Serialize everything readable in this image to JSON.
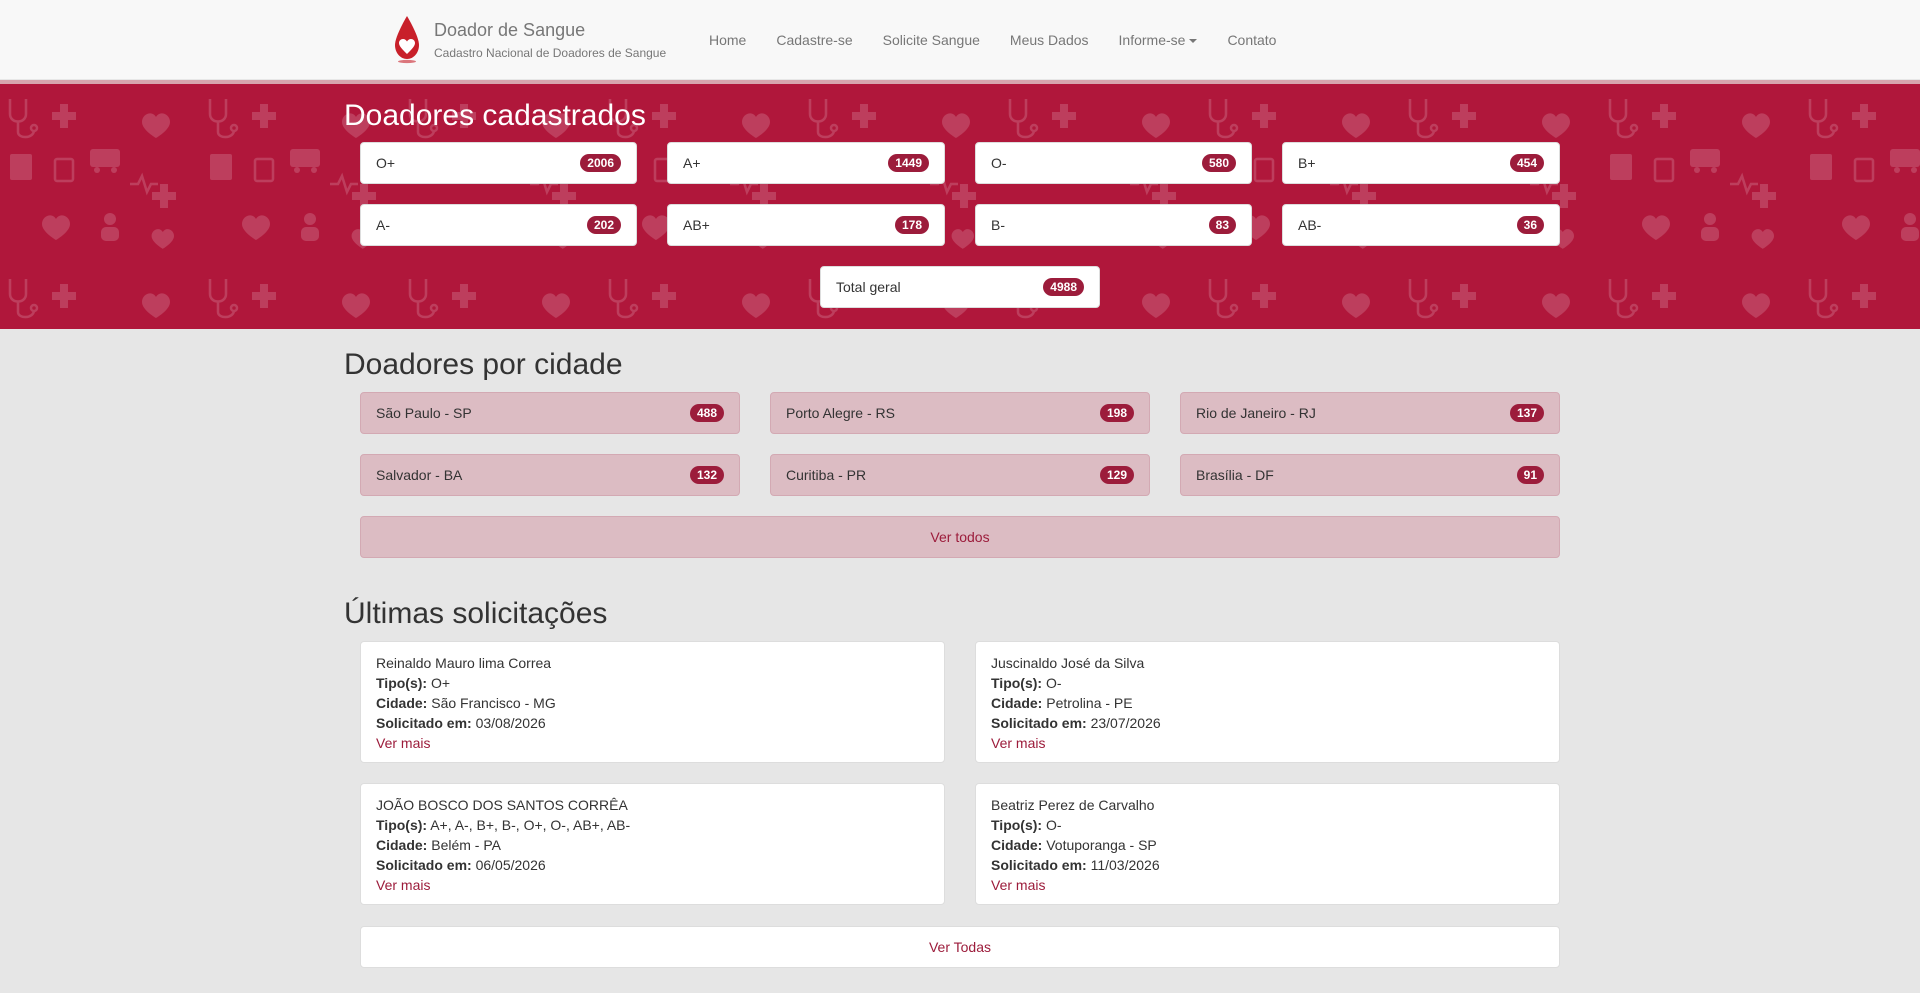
{
  "brand": {
    "title": "Doador de Sangue",
    "subtitle": "Cadastro Nacional de Doadores de Sangue",
    "logo_icon": "blood-drop-heart-icon"
  },
  "nav": {
    "items": [
      "Home",
      "Cadastre-se",
      "Solicite Sangue",
      "Meus Dados",
      "Informe-se",
      "Contato"
    ]
  },
  "colors": {
    "accent": "#9c1c3b",
    "hero_bg": "#b0173b",
    "city_box_bg": "#dcbcc3",
    "page_bg": "#e6e6e6"
  },
  "donors": {
    "title": "Doadores cadastrados",
    "types": [
      {
        "label": "O+",
        "count": "2006"
      },
      {
        "label": "A+",
        "count": "1449"
      },
      {
        "label": "O-",
        "count": "580"
      },
      {
        "label": "B+",
        "count": "454"
      },
      {
        "label": "A-",
        "count": "202"
      },
      {
        "label": "AB+",
        "count": "178"
      },
      {
        "label": "B-",
        "count": "83"
      },
      {
        "label": "AB-",
        "count": "36"
      }
    ],
    "total_label": "Total geral",
    "total_count": "4988"
  },
  "cities": {
    "title": "Doadores por cidade",
    "items": [
      {
        "label": "São Paulo - SP",
        "count": "488"
      },
      {
        "label": "Porto Alegre - RS",
        "count": "198"
      },
      {
        "label": "Rio de Janeiro - RJ",
        "count": "137"
      },
      {
        "label": "Salvador - BA",
        "count": "132"
      },
      {
        "label": "Curitiba - PR",
        "count": "129"
      },
      {
        "label": "Brasília - DF",
        "count": "91"
      }
    ],
    "see_all": "Ver todos"
  },
  "requests": {
    "title": "Últimas solicitações",
    "labels": {
      "types": "Tipo(s):",
      "city": "Cidade:",
      "requested": "Solicitado em:",
      "more": "Ver mais"
    },
    "items": [
      {
        "name": "Reinaldo Mauro lima Correa",
        "types": "O+",
        "city": "São Francisco - MG",
        "date": "03/08/2026"
      },
      {
        "name": "Juscinaldo José da Silva",
        "types": "O-",
        "city": "Petrolina - PE",
        "date": "23/07/2026"
      },
      {
        "name": "JOÃO BOSCO DOS SANTOS CORRÊA",
        "types": "A+, A-, B+, B-, O+, O-, AB+, AB-",
        "city": "Belém - PA",
        "date": "06/05/2026"
      },
      {
        "name": "Beatriz Perez de Carvalho",
        "types": "O-",
        "city": "Votuporanga - SP",
        "date": "11/03/2026"
      }
    ],
    "see_all": "Ver Todas"
  }
}
